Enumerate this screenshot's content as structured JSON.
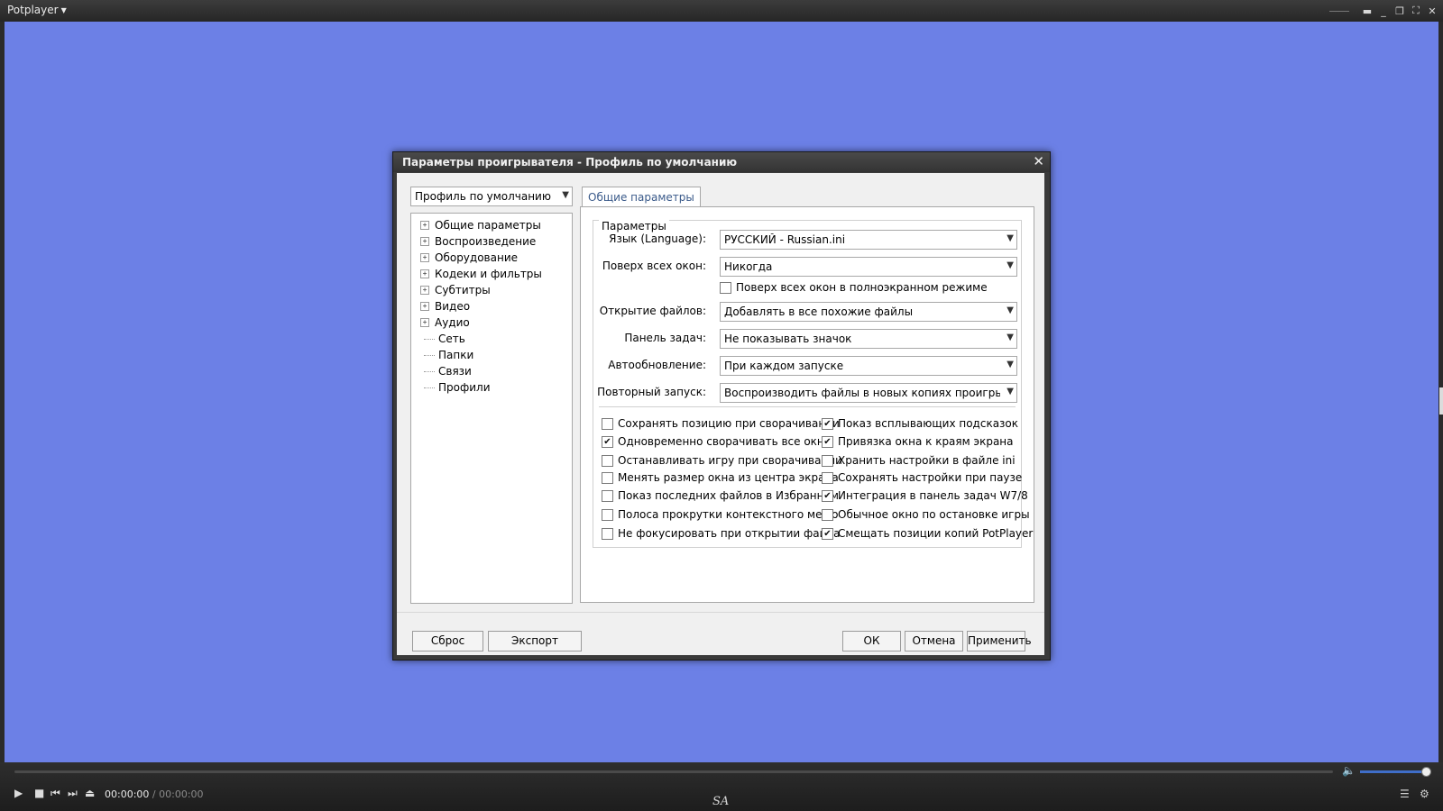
{
  "player": {
    "app_name": "Potplayer",
    "time_current": "00:00:00",
    "time_separator": "/",
    "time_total": "00:00:00",
    "brand": "SA",
    "video_bg": "#6c80e6"
  },
  "dialog": {
    "title": "Параметры проигрывателя - Профиль по умолчанию",
    "profile_selected": "Профиль по умолчанию",
    "tree": [
      {
        "label": "Общие параметры",
        "expandable": true
      },
      {
        "label": "Воспроизведение",
        "expandable": true
      },
      {
        "label": "Оборудование",
        "expandable": true
      },
      {
        "label": "Кодеки и фильтры",
        "expandable": true
      },
      {
        "label": "Субтитры",
        "expandable": true
      },
      {
        "label": "Видео",
        "expandable": true
      },
      {
        "label": "Аудио",
        "expandable": true
      },
      {
        "label": "Сеть",
        "expandable": false
      },
      {
        "label": "Папки",
        "expandable": false
      },
      {
        "label": "Связи",
        "expandable": false
      },
      {
        "label": "Профили",
        "expandable": false
      }
    ],
    "tab_label": "Общие параметры",
    "group_label": "Параметры",
    "fields": [
      {
        "label": "Язык (Language):",
        "value": "РУССКИЙ - Russian.ini"
      },
      {
        "label": "Поверх всех окон:",
        "value": "Никогда"
      },
      {
        "label": "Открытие файлов:",
        "value": "Добавлять в все похожие файлы"
      },
      {
        "label": "Панель задач:",
        "value": "Не показывать значок"
      },
      {
        "label": "Автообновление:",
        "value": "При каждом запуске"
      },
      {
        "label": "Повторный запуск:",
        "value": "Воспроизводить файлы в новых копиях проигрывателя"
      }
    ],
    "fullscreen_topmost": {
      "label": "Поверх всех окон в полноэкранном режиме",
      "checked": false
    },
    "checkboxes_left": [
      {
        "label": "Сохранять позицию при сворачивании",
        "checked": false
      },
      {
        "label": "Одновременно сворачивать все окна",
        "checked": true
      },
      {
        "label": "Останавливать игру при сворачивании",
        "checked": false
      },
      {
        "label": "Менять размер окна из центра экрана",
        "checked": false
      },
      {
        "label": "Показ последних файлов в Избранном",
        "checked": false
      },
      {
        "label": "Полоса прокрутки контекстного меню",
        "checked": false
      },
      {
        "label": "Не фокусировать при открытии файла",
        "checked": false
      }
    ],
    "checkboxes_right": [
      {
        "label": "Показ всплывающих подсказок",
        "checked": true
      },
      {
        "label": "Привязка окна к краям экрана",
        "checked": true
      },
      {
        "label": "Хранить настройки в файле ini",
        "checked": false
      },
      {
        "label": "Сохранять настройки при паузе",
        "checked": false
      },
      {
        "label": "Интеграция в панель задач W7/8",
        "checked": true
      },
      {
        "label": "Обычное окно по остановке игры",
        "checked": false
      },
      {
        "label": "Смещать позиции копий PotPlayer",
        "checked": true
      }
    ],
    "buttons": {
      "reset": "Сброс",
      "export": "Экспорт",
      "ok": "ОК",
      "cancel": "Отмена",
      "apply": "Применить"
    }
  }
}
